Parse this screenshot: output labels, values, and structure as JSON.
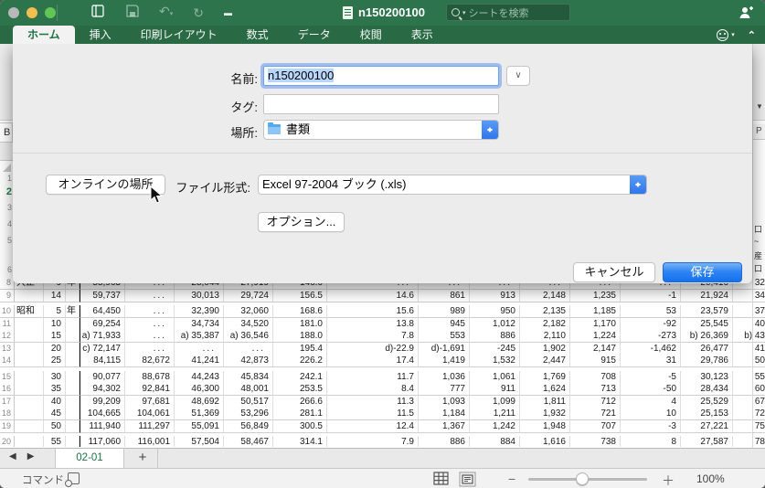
{
  "titlebar": {
    "title": "n150200100",
    "search_placeholder": "シートを検索"
  },
  "ribbon": {
    "tabs": [
      {
        "label": "ホーム",
        "active": true
      },
      {
        "label": "挿入",
        "active": false
      },
      {
        "label": "印刷レイアウト",
        "active": false
      },
      {
        "label": "数式",
        "active": false
      },
      {
        "label": "データ",
        "active": false
      },
      {
        "label": "校閲",
        "active": false
      },
      {
        "label": "表示",
        "active": false
      }
    ]
  },
  "dialog": {
    "name_label": "名前:",
    "name_value": "n150200100",
    "tags_label": "タグ:",
    "tags_value": "",
    "where_label": "場所:",
    "where_value": "書類",
    "online_button": "オンラインの場所",
    "format_label": "ファイル形式:",
    "format_value": "Excel 97-2004 ブック (.xls)",
    "options_button": "オプション...",
    "cancel_button": "キャンセル",
    "save_button": "保存"
  },
  "sheet": {
    "left_row_numbers": [
      "1",
      "2",
      "3",
      "4",
      "5",
      "6"
    ],
    "right_col_header": "P",
    "right_fragments": [
      "口",
      "~",
      "産",
      "口"
    ],
    "rows": [
      {
        "n": "8",
        "era": "大正",
        "y": "9",
        "u": "年",
        "c": [
          "55,963",
          "...",
          "28,044",
          "27,919",
          "146.6",
          "...",
          "...",
          "...",
          "...",
          "...",
          "...",
          "20,416",
          "32"
        ]
      },
      {
        "n": "9",
        "era": "",
        "y": "14",
        "u": "",
        "c": [
          "59,737",
          "...",
          "30,013",
          "29,724",
          "156.5",
          "14.6",
          "861",
          "913",
          "2,148",
          "1,235",
          "-1",
          "21,924",
          "34"
        ]
      },
      {
        "n": "10",
        "era": "昭和",
        "y": "5",
        "u": "年",
        "c": [
          "64,450",
          "...",
          "32,390",
          "32,060",
          "168.6",
          "15.6",
          "989",
          "950",
          "2,135",
          "1,185",
          "53",
          "23,579",
          "37"
        ]
      },
      {
        "n": "11",
        "era": "",
        "y": "10",
        "u": "",
        "c": [
          "69,254",
          "...",
          "34,734",
          "34,520",
          "181.0",
          "13.8",
          "945",
          "1,012",
          "2,182",
          "1,170",
          "-92",
          "25,545",
          "40"
        ]
      },
      {
        "n": "12",
        "era": "",
        "y": "15",
        "u": "",
        "c": [
          "a) 71,933",
          "...",
          "a) 35,387",
          "a) 36,546",
          "188.0",
          "7.8",
          "553",
          "886",
          "2,110",
          "1,224",
          "-273",
          "b) 26,369",
          "b) 43"
        ]
      },
      {
        "n": "13",
        "era": "",
        "y": "20",
        "u": "",
        "c": [
          "c) 72,147",
          "...",
          "...",
          "...",
          "195.4",
          "d)-22.9",
          "d)-1,691",
          "-245",
          "1,902",
          "2,147",
          "-1,462",
          "26,477",
          "41"
        ]
      },
      {
        "n": "14",
        "era": "",
        "y": "25",
        "u": "",
        "c": [
          "84,115",
          "82,672",
          "41,241",
          "42,873",
          "226.2",
          "17.4",
          "1,419",
          "1,532",
          "2,447",
          "915",
          "31",
          "29,786",
          "50"
        ]
      },
      {
        "n": "15",
        "era": "",
        "y": "30",
        "u": "",
        "c": [
          "90,077",
          "88,678",
          "44,243",
          "45,834",
          "242.1",
          "11.7",
          "1,036",
          "1,061",
          "1,769",
          "708",
          "-5",
          "30,123",
          "55"
        ]
      },
      {
        "n": "16",
        "era": "",
        "y": "35",
        "u": "",
        "c": [
          "94,302",
          "92,841",
          "46,300",
          "48,001",
          "253.5",
          "8.4",
          "777",
          "911",
          "1,624",
          "713",
          "-50",
          "28,434",
          "60"
        ]
      },
      {
        "n": "17",
        "era": "",
        "y": "40",
        "u": "",
        "c": [
          "99,209",
          "97,681",
          "48,692",
          "50,517",
          "266.6",
          "11.3",
          "1,093",
          "1,099",
          "1,811",
          "712",
          "4",
          "25,529",
          "67"
        ]
      },
      {
        "n": "18",
        "era": "",
        "y": "45",
        "u": "",
        "c": [
          "104,665",
          "104,061",
          "51,369",
          "53,296",
          "281.1",
          "11.5",
          "1,184",
          "1,211",
          "1,932",
          "721",
          "10",
          "25,153",
          "72"
        ]
      },
      {
        "n": "19",
        "era": "",
        "y": "50",
        "u": "",
        "c": [
          "111,940",
          "111,297",
          "55,091",
          "56,849",
          "300.5",
          "12.4",
          "1,367",
          "1,242",
          "1,948",
          "707",
          "-3",
          "27,221",
          "75"
        ]
      },
      {
        "n": "20",
        "era": "",
        "y": "55",
        "u": "",
        "c": [
          "117,060",
          "116,001",
          "57,504",
          "58,467",
          "314.1",
          "7.9",
          "886",
          "884",
          "1,616",
          "738",
          "8",
          "27,587",
          "78"
        ]
      }
    ]
  },
  "tabstrip": {
    "sheet_tab": "02-01",
    "add_label": "+"
  },
  "statusbar": {
    "mode": "コマンド",
    "zoom": "100%"
  },
  "colors": {
    "titlebar_green": "#2d744c",
    "tabbar_green": "#296a44",
    "active_tab_text": "#1f7145",
    "save_button_blue": "#3085f3",
    "selection_blue": "#b9d7fd",
    "light_red": "#b8b8b8",
    "light_yellow": "#f6be50",
    "light_green": "#62c654"
  }
}
